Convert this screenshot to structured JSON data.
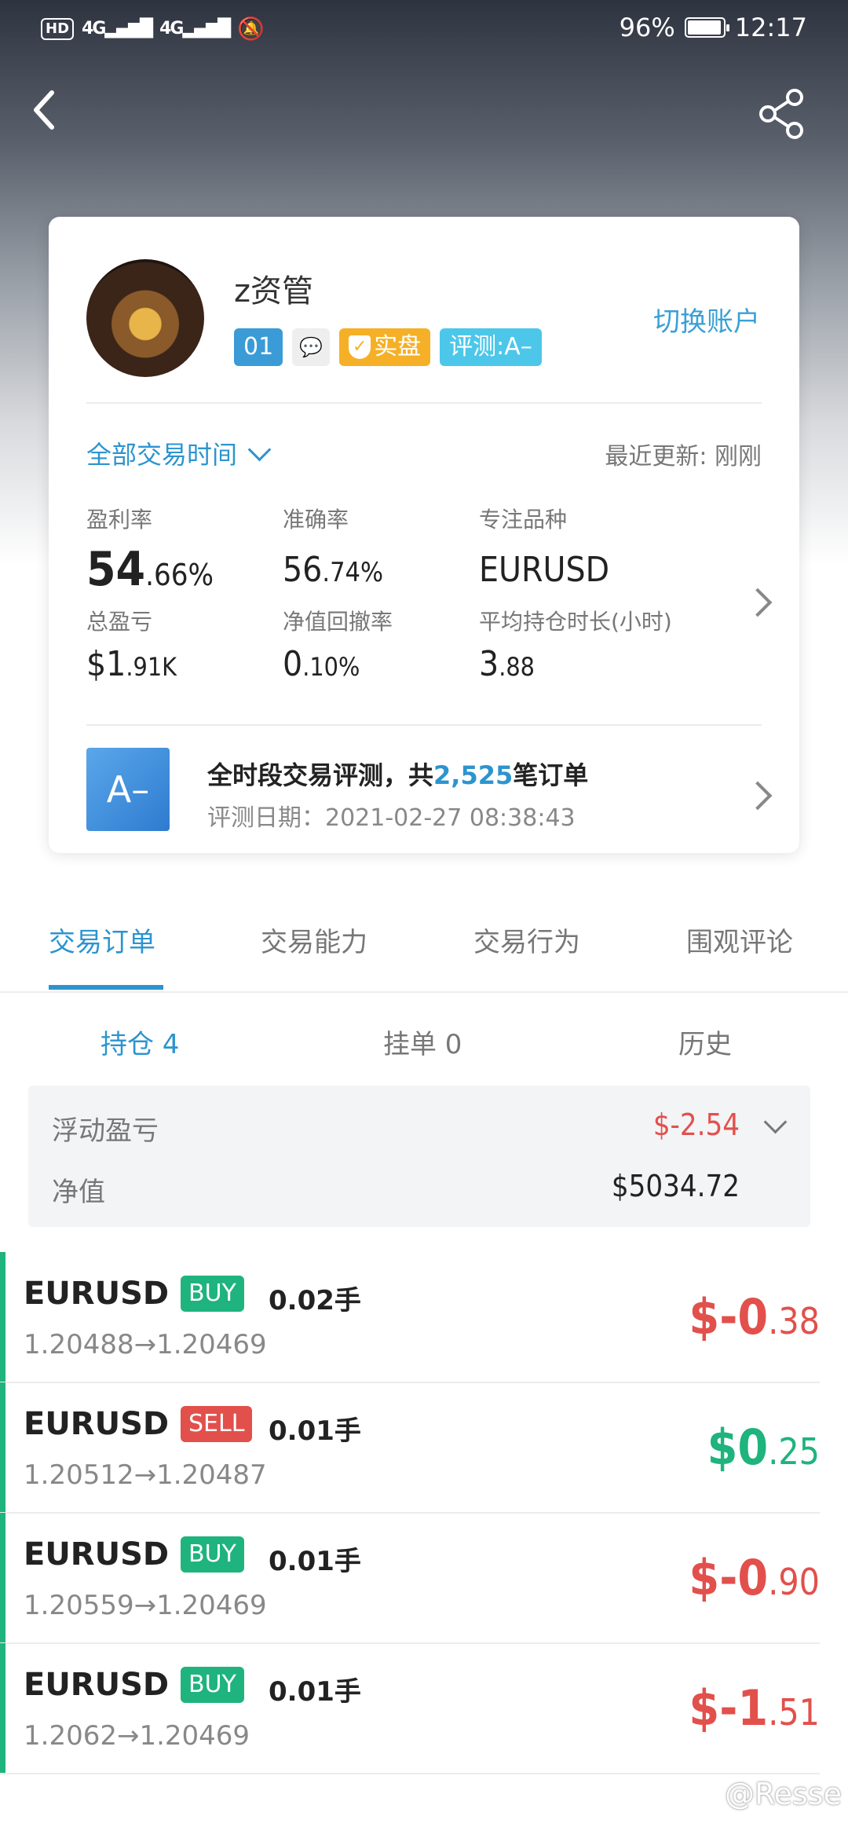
{
  "status_bar": {
    "hd": "HD",
    "sim1": "4G",
    "sim2": "4G",
    "battery": "96%",
    "time": "12:17"
  },
  "profile": {
    "name": "z资管",
    "badge_level": "01",
    "badge_real": "实盘",
    "badge_rating": "评测:A–",
    "switch_account": "切换账户"
  },
  "filter": {
    "period": "全部交易时间",
    "updated": "最近更新: 刚刚"
  },
  "stats": {
    "profit_rate_label": "盈利率",
    "profit_rate_int": "54",
    "profit_rate_dec": ".66%",
    "accuracy_label": "准确率",
    "accuracy_int": "56",
    "accuracy_dec": ".74%",
    "focus_label": "专注品种",
    "focus_value": "EURUSD",
    "total_pnl_label": "总盈亏",
    "total_pnl_int": "$1",
    "total_pnl_dec": ".91K",
    "drawdown_label": "净值回撤率",
    "drawdown_int": "0",
    "drawdown_dec": ".10%",
    "avg_hold_label": "平均持仓时长(小时)",
    "avg_hold_int": "3",
    "avg_hold_dec": ".88"
  },
  "evaluation": {
    "grade": "A–",
    "title_pre": "全时段交易评测，共",
    "orders_count": "2,525",
    "title_post": "笔订单",
    "date": "评测日期：2021-02-27 08:38:43"
  },
  "tabs": [
    "交易订单",
    "交易能力",
    "交易行为",
    "围观评论"
  ],
  "subtabs": [
    "持仓 4",
    "挂单 0",
    "历史"
  ],
  "summary": {
    "floating_label": "浮动盈亏",
    "floating_value": "$-2.54",
    "equity_label": "净值",
    "equity_value": "$5034.72"
  },
  "orders": [
    {
      "symbol": "EURUSD",
      "side": "BUY",
      "lots": "0.02手",
      "prices": "1.20488→1.20469",
      "pnl_int": "$-0",
      "pnl_dec": ".38"
    },
    {
      "symbol": "EURUSD",
      "side": "SELL",
      "lots": "0.01手",
      "prices": "1.20512→1.20487",
      "pnl_int": "$0",
      "pnl_dec": ".25"
    },
    {
      "symbol": "EURUSD",
      "side": "BUY",
      "lots": "0.01手",
      "prices": "1.20559→1.20469",
      "pnl_int": "$-0",
      "pnl_dec": ".90"
    },
    {
      "symbol": "EURUSD",
      "side": "BUY",
      "lots": "0.01手",
      "prices": "1.2062→1.20469",
      "pnl_int": "$-1",
      "pnl_dec": ".51"
    }
  ],
  "watermark": "@Resse",
  "colors": {
    "accent": "#2c94cf",
    "profit": "#1fb37e",
    "loss": "#e2504c"
  }
}
